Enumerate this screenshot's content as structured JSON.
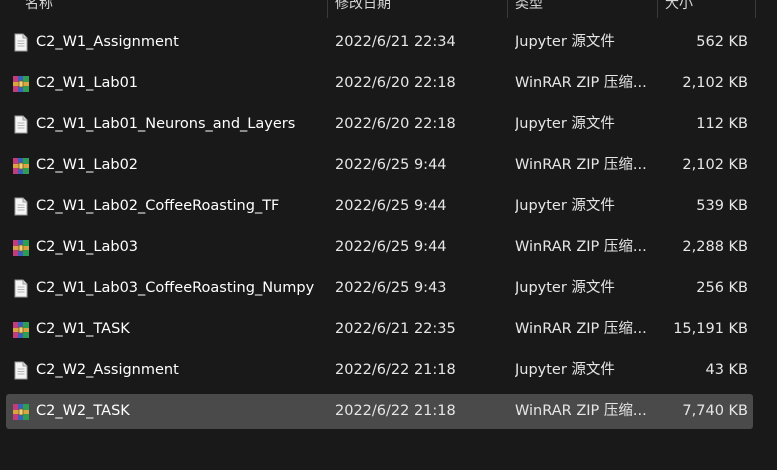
{
  "columns": {
    "name": "名称",
    "modified": "修改日期",
    "type": "类型",
    "size": "大小"
  },
  "icons": {
    "notebook": "document-icon",
    "archive": "winrar-archive-icon"
  },
  "files": [
    {
      "name": "C2_W1_Assignment",
      "modified": "2022/6/21 22:34",
      "type": "Jupyter 源文件",
      "size": "562 KB",
      "kind": "notebook"
    },
    {
      "name": "C2_W1_Lab01",
      "modified": "2022/6/20 22:18",
      "type": "WinRAR ZIP 压缩...",
      "size": "2,102 KB",
      "kind": "archive"
    },
    {
      "name": "C2_W1_Lab01_Neurons_and_Layers",
      "modified": "2022/6/20 22:18",
      "type": "Jupyter 源文件",
      "size": "112 KB",
      "kind": "notebook"
    },
    {
      "name": "C2_W1_Lab02",
      "modified": "2022/6/25 9:44",
      "type": "WinRAR ZIP 压缩...",
      "size": "2,102 KB",
      "kind": "archive"
    },
    {
      "name": "C2_W1_Lab02_CoffeeRoasting_TF",
      "modified": "2022/6/25 9:44",
      "type": "Jupyter 源文件",
      "size": "539 KB",
      "kind": "notebook"
    },
    {
      "name": "C2_W1_Lab03",
      "modified": "2022/6/25 9:44",
      "type": "WinRAR ZIP 压缩...",
      "size": "2,288 KB",
      "kind": "archive"
    },
    {
      "name": "C2_W1_Lab03_CoffeeRoasting_Numpy",
      "modified": "2022/6/25 9:43",
      "type": "Jupyter 源文件",
      "size": "256 KB",
      "kind": "notebook"
    },
    {
      "name": "C2_W1_TASK",
      "modified": "2022/6/21 22:35",
      "type": "WinRAR ZIP 压缩...",
      "size": "15,191 KB",
      "kind": "archive"
    },
    {
      "name": "C2_W2_Assignment",
      "modified": "2022/6/22 21:18",
      "type": "Jupyter 源文件",
      "size": "43 KB",
      "kind": "notebook"
    },
    {
      "name": "C2_W2_TASK",
      "modified": "2022/6/22 21:18",
      "type": "WinRAR ZIP 压缩...",
      "size": "7,740 KB",
      "kind": "archive",
      "selected": true
    }
  ]
}
